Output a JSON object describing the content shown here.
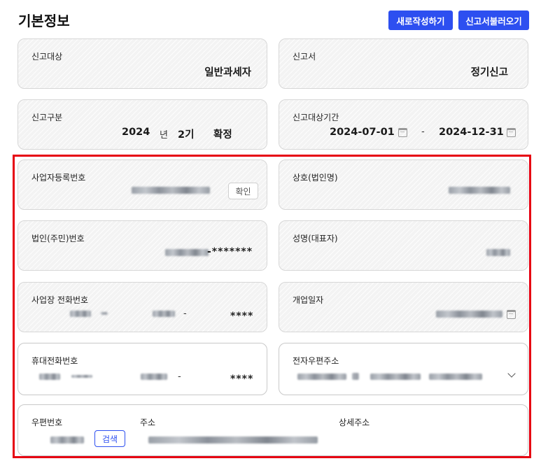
{
  "header": {
    "title": "기본정보",
    "new_button": "새로작성하기",
    "load_button": "신고서불러오기"
  },
  "report_target": {
    "label": "신고대상",
    "value": "일반과세자"
  },
  "report_form": {
    "label": "신고서",
    "value": "정기신고"
  },
  "report_type": {
    "label": "신고구분",
    "year": "2024",
    "year_unit": "년",
    "period": "2기",
    "status": "확정"
  },
  "report_period": {
    "label": "신고대상기간",
    "start": "2024-07-01",
    "separator": "-",
    "end": "2024-12-31"
  },
  "business_reg_no": {
    "label": "사업자등록번호",
    "confirm_button": "확인"
  },
  "company_name": {
    "label": "상호(법인명)"
  },
  "corp_no": {
    "label": "법인(주민)번호",
    "masked_suffix": "-*******"
  },
  "representative": {
    "label": "성명(대표자)"
  },
  "business_phone": {
    "label": "사업장 전화번호",
    "separator": "-",
    "masked": "****"
  },
  "open_date": {
    "label": "개업일자"
  },
  "mobile_phone": {
    "label": "휴대전화번호",
    "separator": "-",
    "masked": "****"
  },
  "email": {
    "label": "전자우편주소"
  },
  "address": {
    "zip_label": "우편번호",
    "search_button": "검색",
    "address_label": "주소",
    "detail_label": "상세주소"
  },
  "colors": {
    "accent": "#2d4ff0",
    "highlight_border": "#e60012"
  }
}
